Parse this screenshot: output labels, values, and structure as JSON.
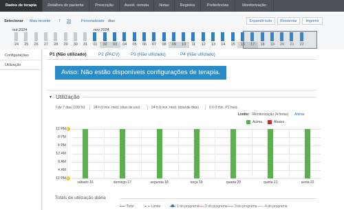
{
  "nav": {
    "tabs": [
      "Dados de terapia",
      "Detalhes do paciente",
      "Prescrição",
      "Assist. remota",
      "Notas",
      "Registos",
      "Preferências",
      "Monitorização"
    ],
    "active": 0
  },
  "selector": {
    "label": "Selecionar",
    "recent_label": "Mais recente",
    "opt_7": "7",
    "opt_30": "30",
    "personalized": "Personalizado",
    "days": "dias",
    "expand": "Expandir tudo",
    "reorient": "Reorientar",
    "print": "Imprimir"
  },
  "timeline": {
    "month_left": "out 2024",
    "month_right": "nov 2024",
    "days": [
      "24",
      "25",
      "26",
      "27",
      "28",
      "29",
      "30",
      "31",
      "01",
      "02",
      "03",
      "04",
      "05",
      "06",
      "07",
      "08",
      "09",
      "10",
      "11",
      "12",
      "13",
      "14",
      "15",
      "16",
      "17",
      "18",
      "19",
      "20",
      "21",
      "22"
    ],
    "highlighted": [
      "02",
      "03",
      "09",
      "10",
      "16",
      "17"
    ]
  },
  "sidebar": {
    "items": [
      "Configurações",
      "Utilização"
    ]
  },
  "profiles": [
    "P1 (Não utilizado)",
    "P2 (PACV)",
    "P3 (Não utilizado)",
    "P4 (Não utilizado)"
  ],
  "warning": "Aviso: Não estão disponíveis configurações de terapia.",
  "usage": {
    "title": "Utilização",
    "stats": [
      "7 de 7 dias (100 %)",
      "24 h 0 min. med. (dias de uso)",
      "24 h 0 min. med. (total de dias)",
      "0 h 0 min. P1 med."
    ],
    "limit_label": "Limite:",
    "limit_text": "Monitorização (4 horas)",
    "change": "Alterar",
    "legend_above": "Acima",
    "legend_below": "Abaixo"
  },
  "colors": {
    "above": "#5db04e",
    "below": "#d9262e",
    "accent": "#2b6fb5",
    "warning": "#2a8bc9"
  },
  "chart_data": {
    "type": "bar",
    "categories": [
      "sábado 16",
      "domingo 17",
      "segunda 18",
      "terça 19",
      "quarta 20",
      "quinta 21",
      "sexta 22"
    ],
    "series": [
      {
        "name": "Acima",
        "values": [
          24,
          24,
          24,
          24,
          24,
          24,
          24
        ]
      }
    ],
    "yticks": [
      "12 PM",
      "8 PM",
      "4 PM",
      "12 AM",
      "8 AM",
      "4 AM",
      "12 PM"
    ],
    "ylim": [
      0,
      24
    ]
  },
  "totals": {
    "title": "Totais de utilização diária",
    "legend": [
      "Total",
      "Limite",
      "1 do programa",
      "2 do programa",
      "3 do programa",
      "4 do programa"
    ]
  }
}
